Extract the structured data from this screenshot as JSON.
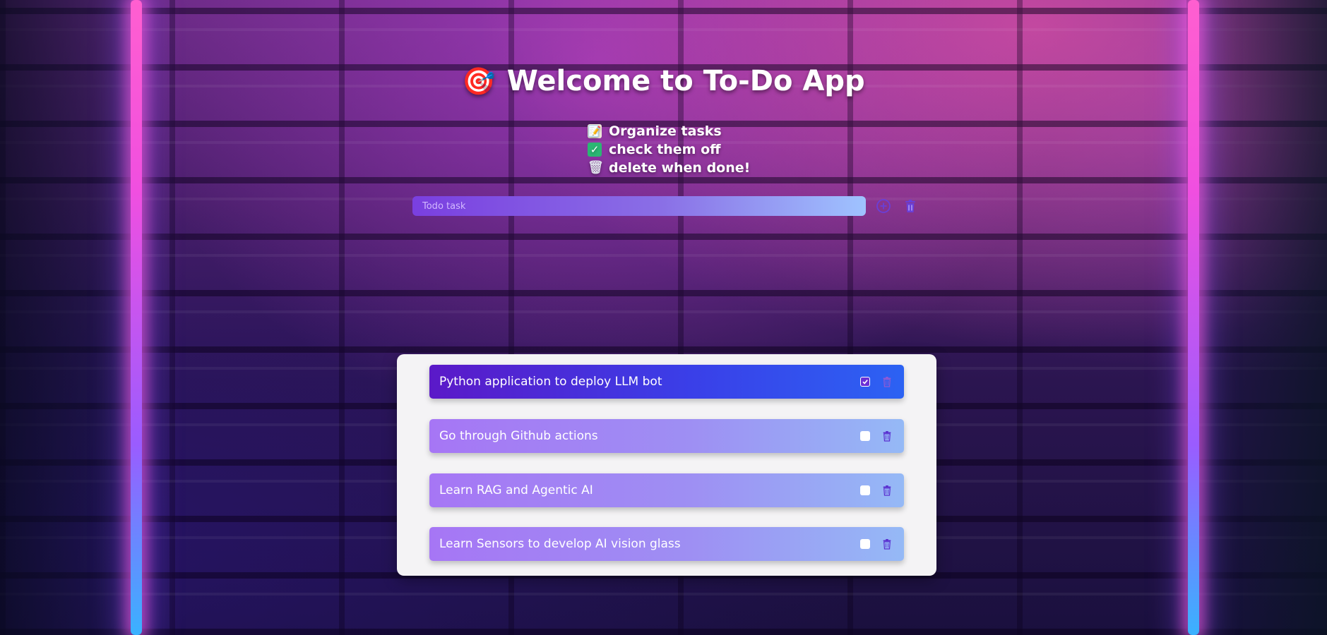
{
  "header": {
    "title": "Welcome to To-Do App",
    "title_emoji": "🎯"
  },
  "features": [
    {
      "icon": "memo-icon",
      "glyph": "📝",
      "label": "Organize tasks"
    },
    {
      "icon": "check-mark-icon",
      "glyph": "✓",
      "label": "check them off"
    },
    {
      "icon": "trash-icon",
      "glyph": "🗑",
      "label": "delete when done!"
    }
  ],
  "input": {
    "placeholder": "Todo task",
    "value": ""
  },
  "tasks": [
    {
      "label": "Python application to deploy LLM bot",
      "checked": true
    },
    {
      "label": "Go through Github actions",
      "checked": false
    },
    {
      "label": "Learn RAG and Agentic AI",
      "checked": false
    },
    {
      "label": "Learn Sensors to develop AI vision glass",
      "checked": false
    }
  ],
  "colors": {
    "neon_pink": "#ff5fd0",
    "neon_blue": "#3ab2ff",
    "accent_purple": "#7a3fe0",
    "task_done_start": "#5b19c8",
    "task_done_end": "#2c62f3",
    "task_start": "#a676f5",
    "task_end": "#95b9f6",
    "icon_purple": "#6a3fd8",
    "panel_bg": "#f4f3f5"
  }
}
